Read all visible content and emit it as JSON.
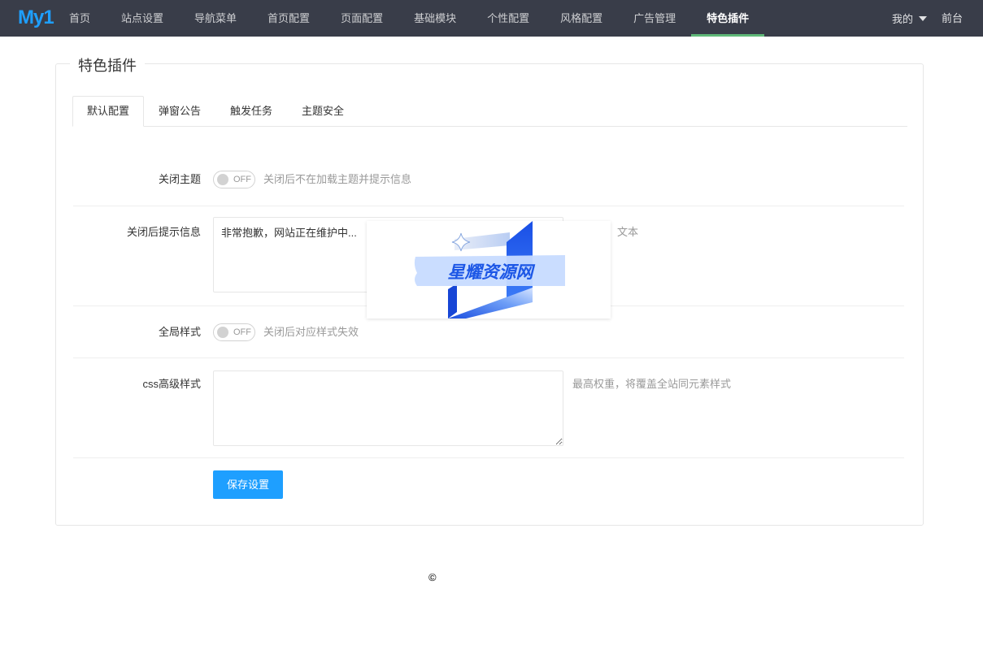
{
  "nav": {
    "logo": "My1",
    "items": [
      {
        "label": "首页",
        "active": false
      },
      {
        "label": "站点设置",
        "active": false
      },
      {
        "label": "导航菜单",
        "active": false
      },
      {
        "label": "首页配置",
        "active": false
      },
      {
        "label": "页面配置",
        "active": false
      },
      {
        "label": "基础模块",
        "active": false
      },
      {
        "label": "个性配置",
        "active": false
      },
      {
        "label": "风格配置",
        "active": false
      },
      {
        "label": "广告管理",
        "active": false
      },
      {
        "label": "特色插件",
        "active": true
      }
    ],
    "user_menu": {
      "label": "我的",
      "icon": "caret-down-icon"
    },
    "frontend_link": "前台"
  },
  "panel": {
    "title": "特色插件",
    "tabs": [
      {
        "label": "默认配置",
        "active": true
      },
      {
        "label": "弹窗公告",
        "active": false
      },
      {
        "label": "触发任务",
        "active": false
      },
      {
        "label": "主题安全",
        "active": false
      }
    ]
  },
  "form": {
    "close_theme": {
      "label": "关闭主题",
      "switch_state": "OFF",
      "on": false,
      "help": "关闭后不在加载主题并提示信息"
    },
    "close_message": {
      "label": "关闭后提示信息",
      "value": "非常抱歉，网站正在维护中...",
      "help": "文本"
    },
    "global_style": {
      "label": "全局样式",
      "switch_state": "OFF",
      "on": false,
      "help": "关闭后对应样式失效"
    },
    "custom_css": {
      "label": "css高级样式",
      "value": "",
      "help": "最高权重，将覆盖全站同元素样式"
    },
    "save_label": "保存设置"
  },
  "footer": {
    "copyright": "©"
  },
  "watermark": {
    "text": "星耀资源网"
  },
  "colors": {
    "nav_bg": "#393D49",
    "accent": "#1E9FFF",
    "active_nav_indicator": "#5FB878",
    "help_text": "#999999"
  }
}
